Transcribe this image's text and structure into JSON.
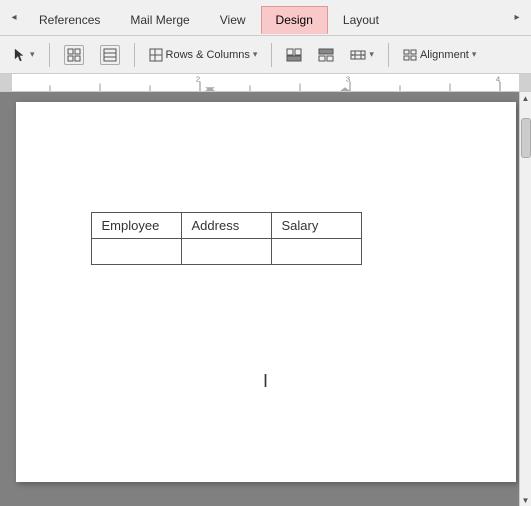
{
  "tabs": [
    {
      "id": "references",
      "label": "References",
      "active": false
    },
    {
      "id": "mail-merge",
      "label": "Mail Merge",
      "active": false
    },
    {
      "id": "view",
      "label": "View",
      "active": false
    },
    {
      "id": "design",
      "label": "Design",
      "active": true
    },
    {
      "id": "layout",
      "label": "Layout",
      "active": false
    }
  ],
  "toolbar": {
    "rows_columns_label": "Rows & Columns",
    "alignment_label": "Alignment"
  },
  "table": {
    "headers": [
      "Employee",
      "Address",
      "Salary"
    ],
    "rows": [
      [
        "",
        "",
        ""
      ]
    ]
  },
  "cursor": "I",
  "nav": {
    "back_arrow": "◂",
    "forward_arrow": "▸",
    "scroll_up": "▲",
    "scroll_down": "▼"
  }
}
